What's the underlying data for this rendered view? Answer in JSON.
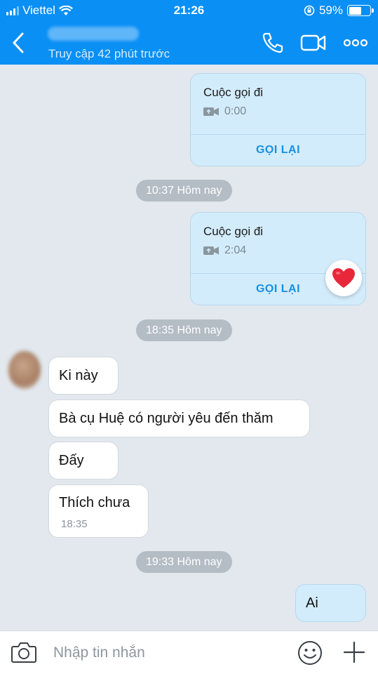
{
  "status_bar": {
    "carrier": "Viettel",
    "time": "21:26",
    "battery_percent": "59%",
    "battery_level": 0.59,
    "icons": [
      "signal-icon",
      "wifi-icon",
      "orientation-lock-icon",
      "battery-icon"
    ]
  },
  "header": {
    "back_icon": "chevron-left-icon",
    "subtitle": "Truy cập 42 phút trước",
    "icons": [
      "phone-icon",
      "video-camera-icon",
      "more-icon"
    ],
    "background": "#0a8ff5"
  },
  "messages": {
    "call_cards": [
      {
        "title": "Cuộc gọi đi",
        "duration": "0:00",
        "action": "GỌI LẠI"
      },
      {
        "title": "Cuộc gọi đi",
        "duration": "2:04",
        "action": "GỌI LẠI"
      }
    ],
    "time_separators": [
      "10:37 Hôm nay",
      "18:35 Hôm nay",
      "19:33 Hôm nay"
    ],
    "received": [
      {
        "text": "Ki này"
      },
      {
        "text": "Bà cụ Huệ có người yêu đến thăm"
      },
      {
        "text": "Đấy"
      },
      {
        "text": "Thích chưa",
        "time": "18:35"
      }
    ],
    "sent": [
      {
        "text": "Ai"
      }
    ],
    "reaction_icon": "heart-icon"
  },
  "input_bar": {
    "placeholder": "Nhập tin nhắn",
    "icons": [
      "camera-icon",
      "emoji-icon",
      "plus-icon"
    ]
  },
  "colors": {
    "accent": "#0a8ff5",
    "chat_background": "#e2e8ee",
    "sent_bubble": "#d3ecfb",
    "received_bubble": "#ffffff",
    "call_back_text": "#1591e6",
    "time_pill": "#b4bcc4"
  }
}
